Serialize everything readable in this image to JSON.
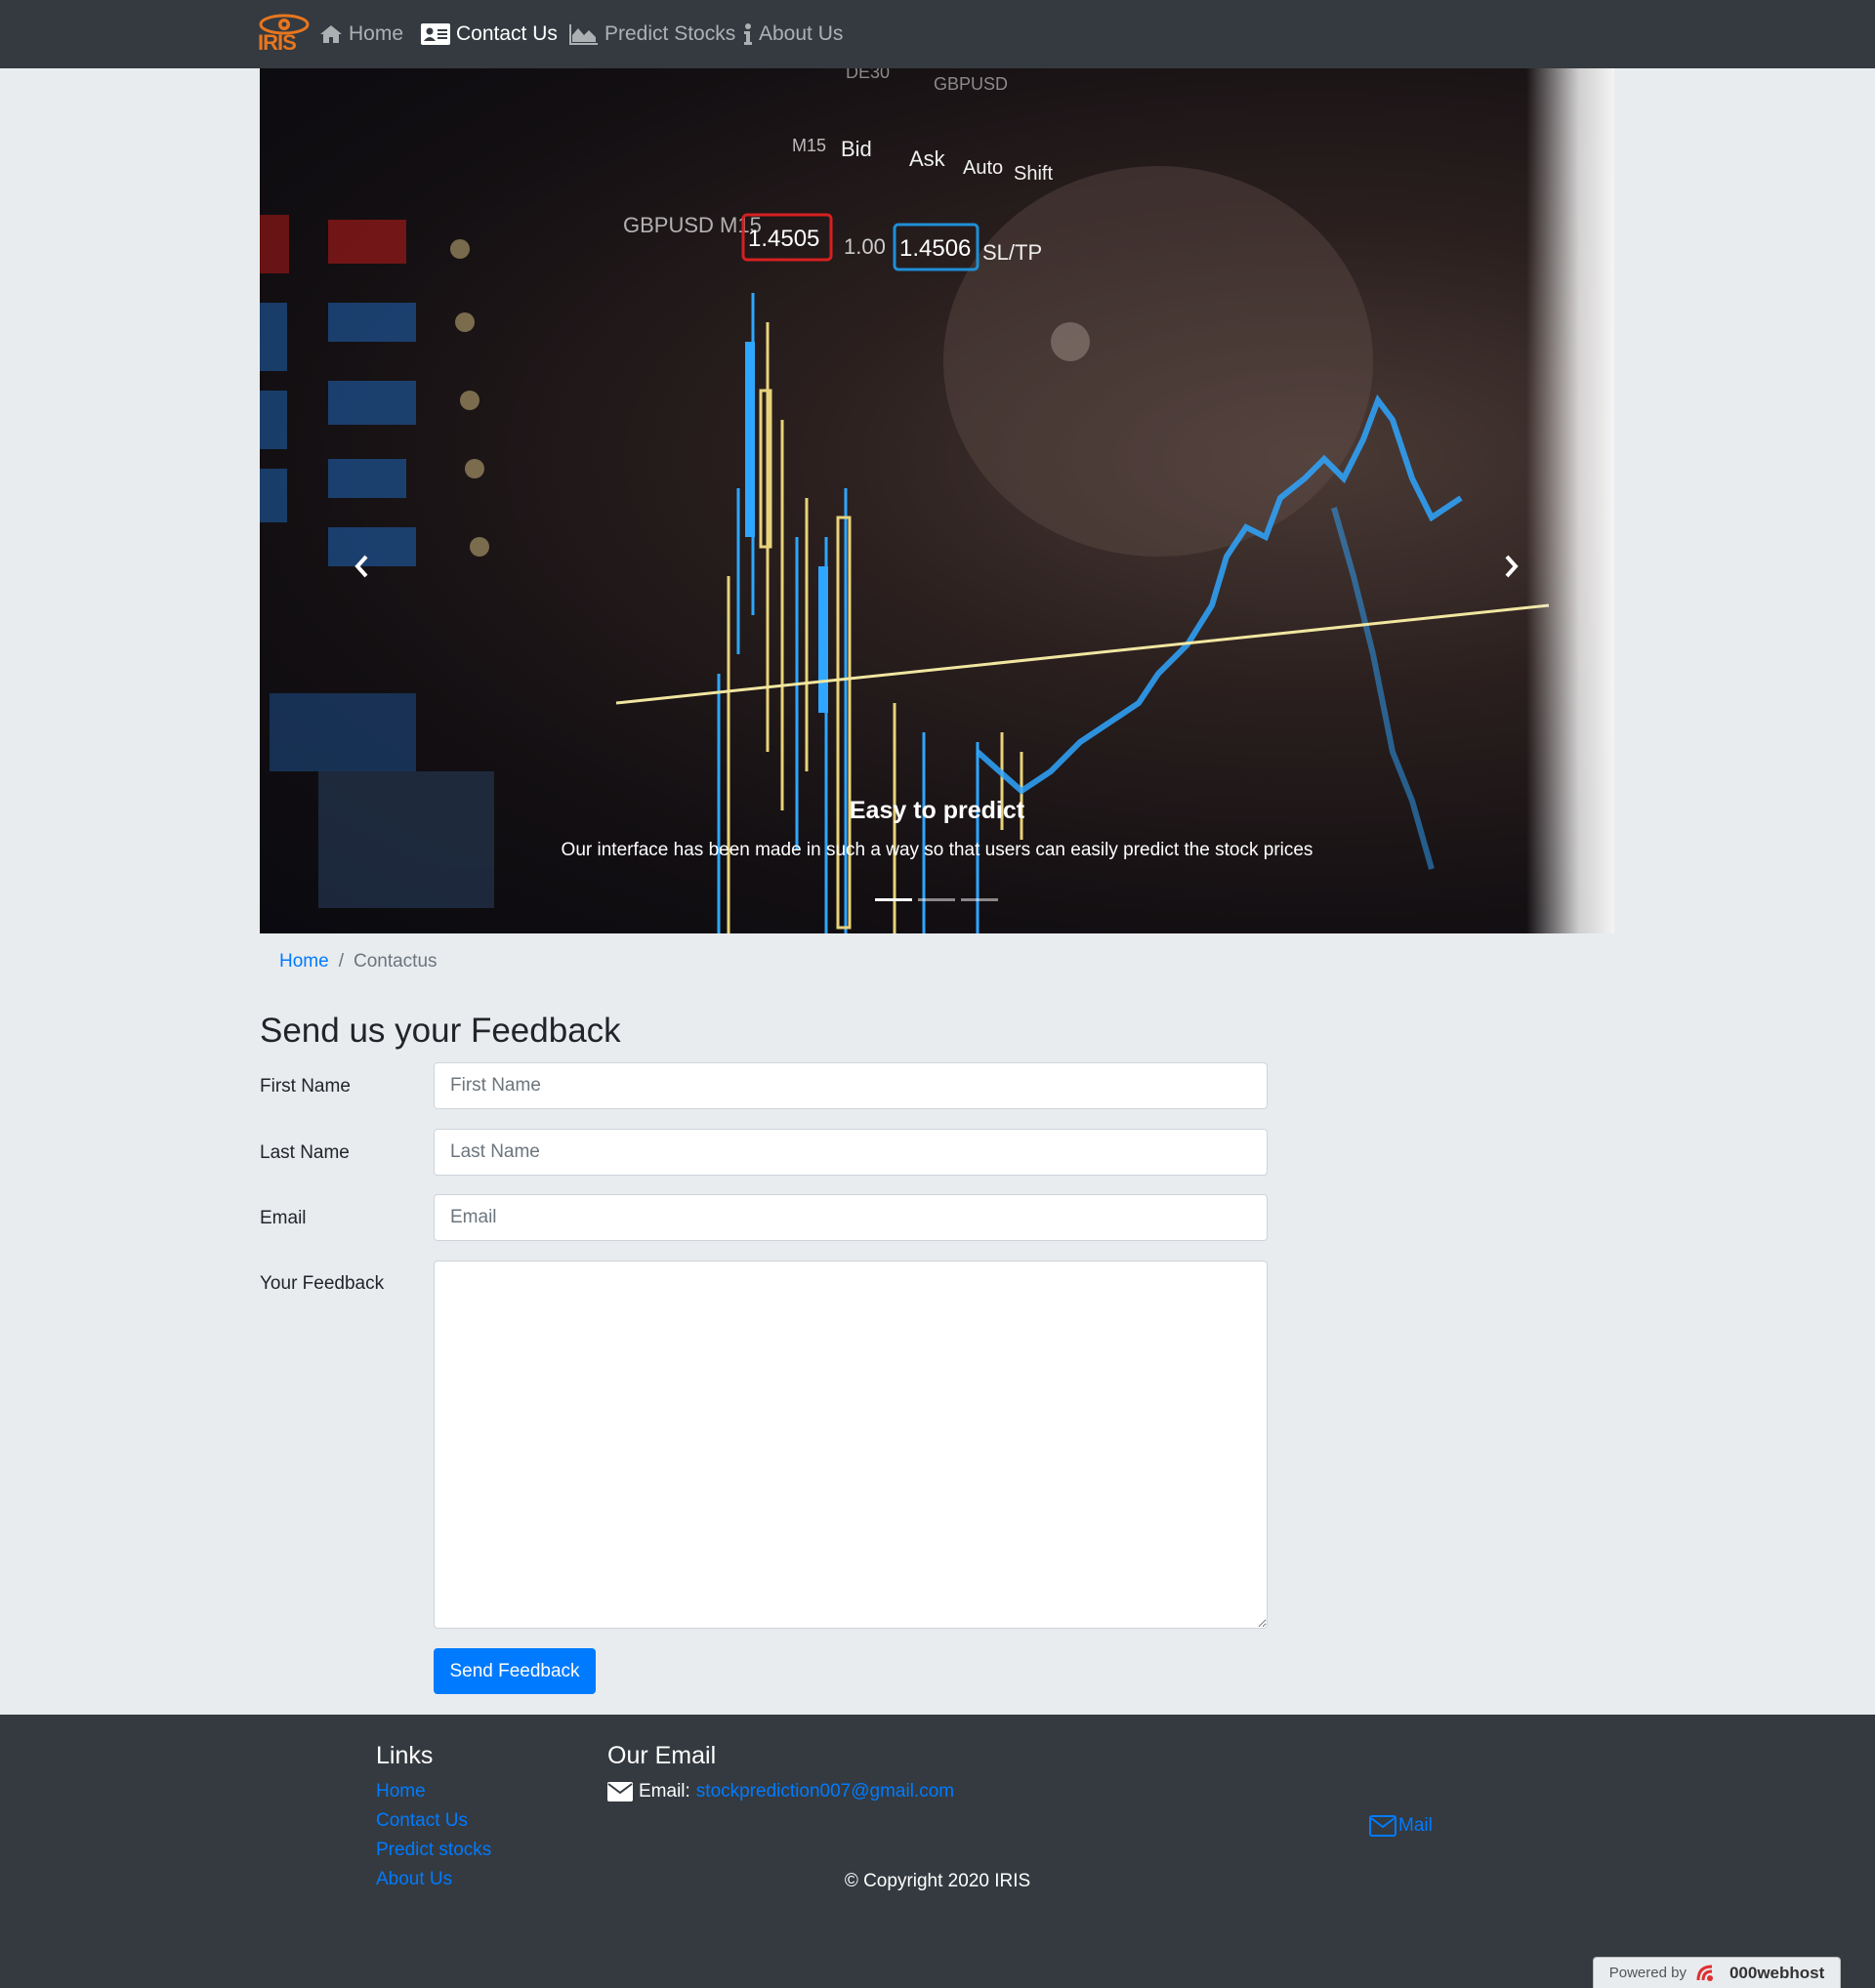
{
  "nav": {
    "brand": "IRIS",
    "items": [
      {
        "label": "Home",
        "icon": "home-icon"
      },
      {
        "label": "Contact Us",
        "icon": "address-card-icon",
        "active": true
      },
      {
        "label": "Predict Stocks",
        "icon": "area-chart-icon"
      },
      {
        "label": "About Us",
        "icon": "info-icon"
      }
    ]
  },
  "carousel": {
    "caption_title": "Easy to predict",
    "caption_text": "Our interface has been made in such a way so that users can easily predict the stock prices",
    "slide_count": 3,
    "active_slide": 0,
    "image_labels": {
      "pair": "GBPUSD M15",
      "bid": "Bid",
      "ask": "Ask",
      "auto": "Auto",
      "shift": "Shift",
      "price1": "1.4505",
      "spread": "1.00",
      "price2": "1.4506",
      "sltp": "SL/TP",
      "top1": "DE30",
      "top2": "GBPUSD",
      "tf": "M15"
    }
  },
  "breadcrumb": {
    "home": "Home",
    "separator": "/",
    "current": "Contactus"
  },
  "form": {
    "title": "Send us your Feedback",
    "first_name_label": "First Name",
    "first_name_placeholder": "First Name",
    "last_name_label": "Last Name",
    "last_name_placeholder": "Last Name",
    "email_label": "Email",
    "email_placeholder": "Email",
    "feedback_label": "Your Feedback",
    "submit_label": "Send Feedback"
  },
  "footer": {
    "links_title": "Links",
    "links": [
      "Home",
      "Contact Us",
      "Predict stocks",
      "About Us"
    ],
    "email_title": "Our Email",
    "email_prefix": "Email:",
    "email_address": "stockprediction007@gmail.com",
    "mail_link": "Mail",
    "copyright": "© Copyright 2020 IRIS",
    "powered_by": "Powered by",
    "host": "000webhost"
  },
  "colors": {
    "navbar": "#343a40",
    "page_bg": "#e9ecef",
    "primary": "#007bff",
    "footer": "#343a40",
    "brand_orange": "#e8761e"
  }
}
